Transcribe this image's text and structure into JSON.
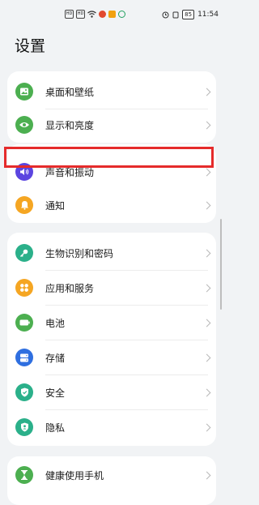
{
  "status_bar": {
    "left_indicators": [
      "HD",
      "HD"
    ],
    "battery": "85",
    "time": "11:54"
  },
  "page_title": "设置",
  "groups": [
    {
      "items": [
        {
          "label": "桌面和壁纸",
          "icon": "wallpaper-icon",
          "color": "#4caf50"
        },
        {
          "label": "显示和亮度",
          "icon": "eye-icon",
          "color": "#4caf50"
        }
      ]
    },
    {
      "items": [
        {
          "label": "声音和振动",
          "icon": "speaker-icon",
          "color": "#5b45e0"
        },
        {
          "label": "通知",
          "icon": "bell-icon",
          "color": "#f5a623"
        }
      ]
    },
    {
      "items": [
        {
          "label": "生物识别和密码",
          "icon": "key-icon",
          "color": "#2bb08a"
        },
        {
          "label": "应用和服务",
          "icon": "apps-icon",
          "color": "#f5a623"
        },
        {
          "label": "电池",
          "icon": "battery-icon",
          "color": "#4caf50"
        },
        {
          "label": "存储",
          "icon": "storage-icon",
          "color": "#2f6fe0"
        },
        {
          "label": "安全",
          "icon": "shield-icon",
          "color": "#2bb08a"
        },
        {
          "label": "隐私",
          "icon": "privacy-icon",
          "color": "#2bb08a"
        }
      ]
    },
    {
      "items": [
        {
          "label": "健康使用手机",
          "icon": "hourglass-icon",
          "color": "#4caf50"
        }
      ]
    }
  ],
  "highlight_color": "#e52b2b"
}
